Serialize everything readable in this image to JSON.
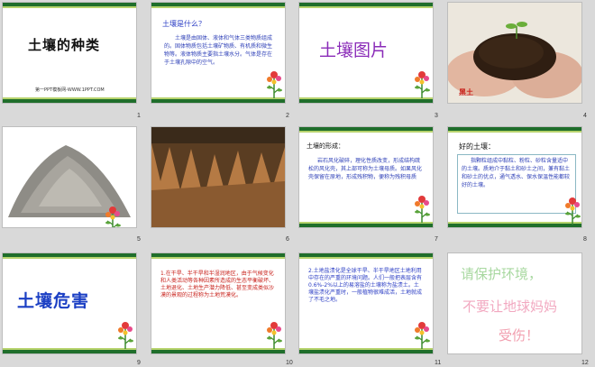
{
  "slides": [
    {
      "num": "1",
      "title": "土壤的种类",
      "footer": "第一PPT模板网-WWW.1PPT.COM"
    },
    {
      "num": "2",
      "heading": "土壤是什么？",
      "text": "土壤是由固体、液体和气体三类物质组成的。固体物质包括土壤矿物质、有机质和微生物等。液体物质主要指土壤水分。气体是存在于土壤孔隙中的空气。"
    },
    {
      "num": "3",
      "title": "土壤图片"
    },
    {
      "num": "4",
      "caption": "黑土"
    },
    {
      "num": "5"
    },
    {
      "num": "6"
    },
    {
      "num": "7",
      "heading": "土壤的形成：",
      "text": "岩石风化破碎，理化性质改变，形成结构疏松的风化壳，其上部可称为土壤母质。如果风化壳保留在原地，形成残积物，便称为残积母质"
    },
    {
      "num": "8",
      "heading": "好的土壤：",
      "text": "指颗粒组成中黏粒、粉粒、砂粒含量适中的土壤。质地介于黏土和砂土之间，兼有黏土和砂土的优点，通气透水、保水保温性能都较好的土壤。"
    },
    {
      "num": "9",
      "title": "土壤危害"
    },
    {
      "num": "10",
      "text": "1.在干旱、半干旱和半湿润地区，由于气候变化和人类活动等各种因素所造成的生态平衡破坏、土地退化、土地生产潜力降低、甚至变成类似沙漠的景观的过程称为土地荒漠化。"
    },
    {
      "num": "11",
      "text": "2.土地盐渍化是全球干旱、半干旱地区土地利用中存在的严重的环境问题。人们一般把表层含有0.6%-2%以上的易溶盐的土壤称为盐渍土。土壤盐渍化严重时，一般植物很难成活，土地就成了不毛之地。"
    },
    {
      "num": "12",
      "line1": "请保护环境，",
      "line2": "不要让地球妈妈",
      "line3": "受伤！"
    }
  ]
}
